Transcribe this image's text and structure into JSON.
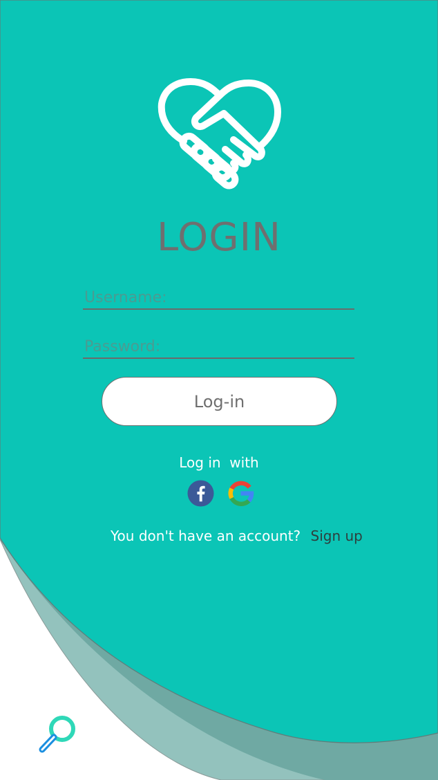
{
  "login": {
    "title": "LOGIN",
    "username_placeholder": "Username:",
    "password_placeholder": "Password:",
    "login_button": "Log-in",
    "login_with_label": "Log in  with",
    "no_account_text": "You don't have an account?",
    "signup_link": "Sign up"
  },
  "icons": {
    "logo": "heart-handshake-icon",
    "facebook": "facebook-icon",
    "google": "google-icon",
    "search": "search-icon"
  },
  "colors": {
    "primary": "#0bc5b6",
    "wave_dark": "#6fa9a3",
    "wave_light": "#93c2bd",
    "text_gray": "#6f6f6f",
    "facebook": "#3b5998"
  }
}
